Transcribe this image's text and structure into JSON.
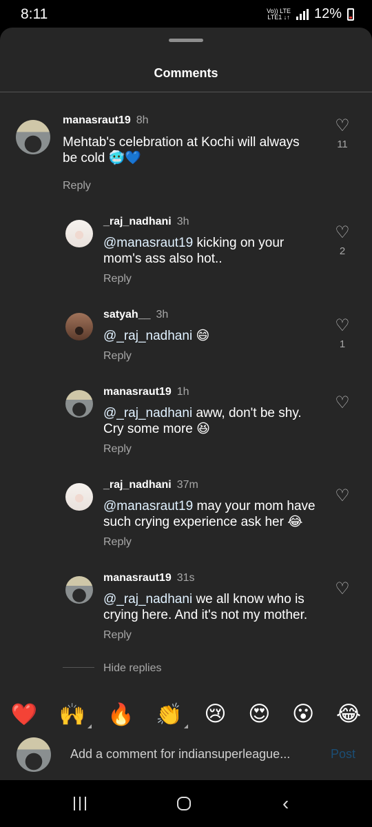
{
  "status": {
    "time": "8:11",
    "net_top": "Vo)) LTE",
    "net_bottom": "LTE1 ↓↑",
    "battery": "12%"
  },
  "sheet": {
    "title": "Comments"
  },
  "comments": [
    {
      "username": "manasraut19",
      "time": "8h",
      "mention": "",
      "text": "Mehtab's celebration at Kochi will always be cold 🥶💙",
      "likes": "11",
      "reply": "Reply"
    },
    {
      "username": "_raj_nadhani",
      "time": "3h",
      "mention": "@manasraut19",
      "text": " kicking on your mom's ass also hot..",
      "likes": "2",
      "reply": "Reply"
    },
    {
      "username": "satyah__",
      "time": "3h",
      "mention": "@_raj_nadhani",
      "text": " 😄",
      "likes": "1",
      "reply": "Reply"
    },
    {
      "username": "manasraut19",
      "time": "1h",
      "mention": "@_raj_nadhani",
      "text": " aww, don't be shy. Cry some more 😆",
      "likes": "",
      "reply": "Reply"
    },
    {
      "username": "_raj_nadhani",
      "time": "37m",
      "mention": "@manasraut19",
      "text": " may your mom have such crying experience ask her 😂",
      "likes": "",
      "reply": "Reply"
    },
    {
      "username": "manasraut19",
      "time": "31s",
      "mention": "@_raj_nadhani",
      "text": " we all know who is crying here. And it's not my mother.",
      "likes": "",
      "reply": "Reply"
    }
  ],
  "hide_replies": "Hide replies",
  "emoji_bar": [
    "❤️",
    "🙌",
    "🔥",
    "👏",
    "😢",
    "😍",
    "😮",
    "😂"
  ],
  "composer": {
    "placeholder": "Add a comment for indiansuperleague...",
    "post": "Post"
  },
  "colors": {
    "sheet_bg": "#262626",
    "post_disabled": "#1b4e75",
    "muted_text": "#a8a8a8"
  }
}
